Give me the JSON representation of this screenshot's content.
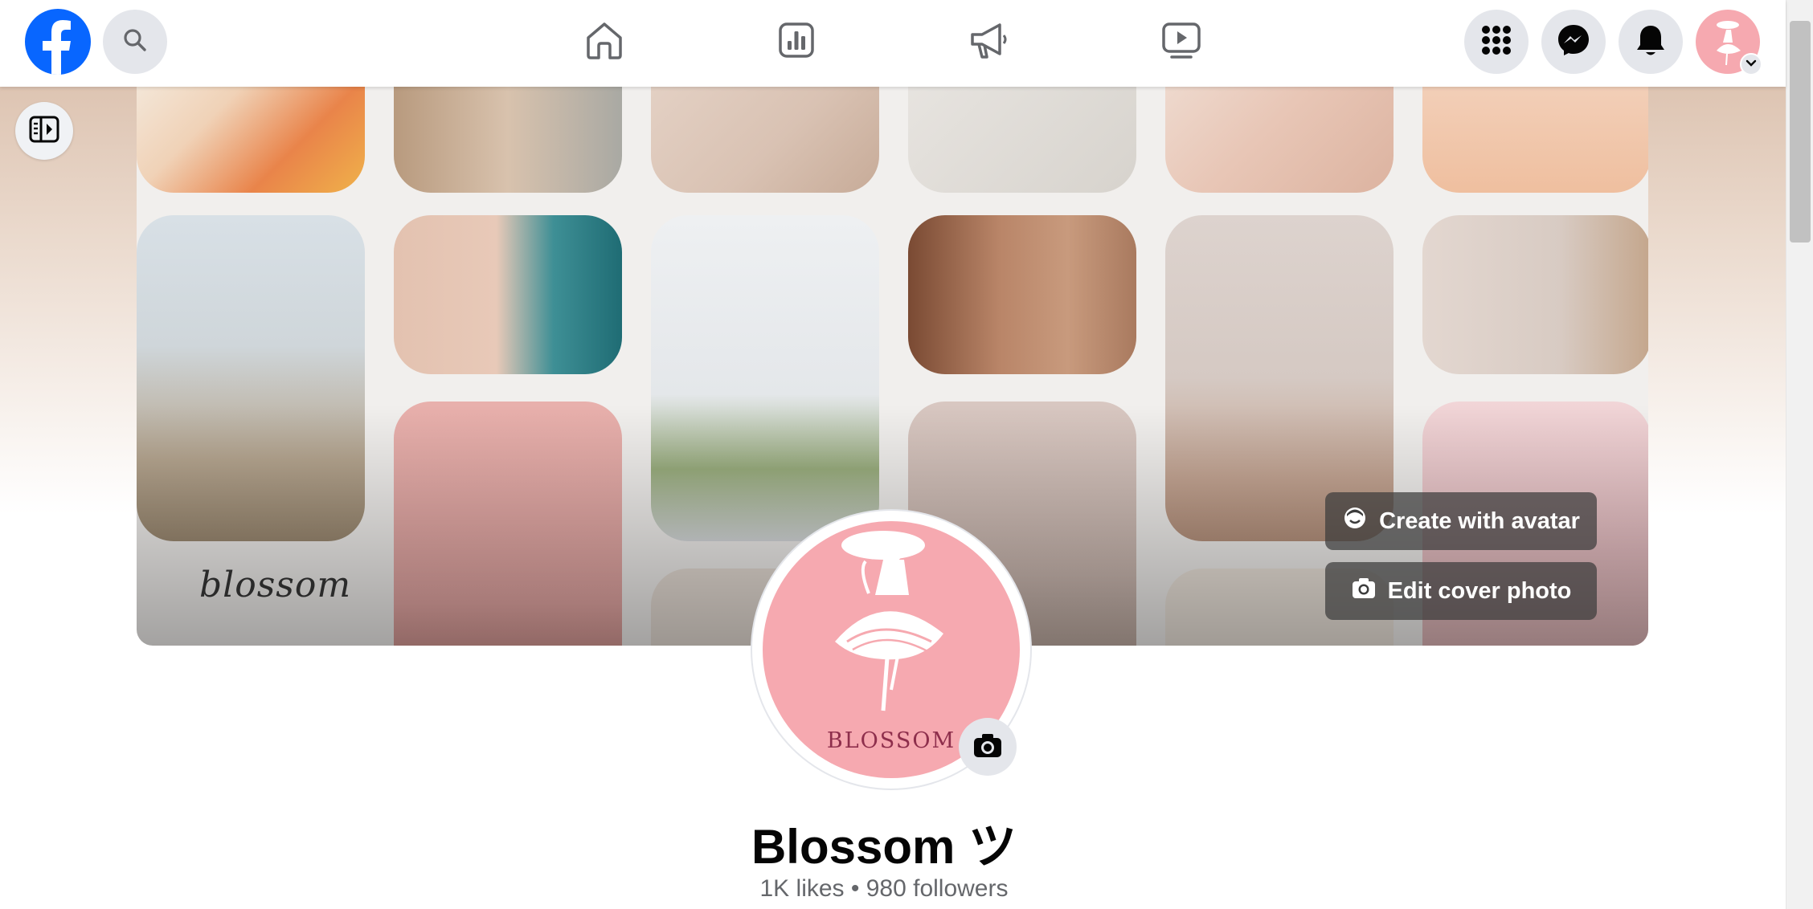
{
  "app": {
    "name": "Facebook",
    "brand_color": "#0866ff"
  },
  "topbar": {
    "search_icon": "search-icon",
    "nav": [
      {
        "name": "home",
        "icon": "home-icon"
      },
      {
        "name": "insights",
        "icon": "chart-icon"
      },
      {
        "name": "ads",
        "icon": "megaphone-icon"
      },
      {
        "name": "video",
        "icon": "video-icon"
      }
    ],
    "menu_icon": "grid-menu-icon",
    "messenger_icon": "messenger-icon",
    "notifications_icon": "bell-icon"
  },
  "cover": {
    "script_text": "blossom",
    "create_avatar_label": "Create with avatar",
    "edit_cover_label": "Edit cover photo"
  },
  "profile": {
    "logo_text": "BLOSSOM",
    "name": "Blossom ツ",
    "stats": "1K likes • 980 followers"
  }
}
